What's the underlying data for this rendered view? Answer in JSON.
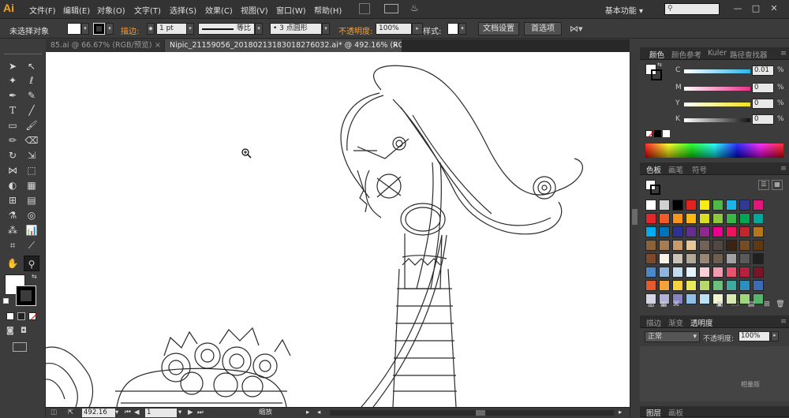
{
  "app": {
    "logo": "Ai",
    "workspace": "基本功能",
    "workspace_arrow": "▾"
  },
  "menu": [
    "文件(F)",
    "编辑(E)",
    "对象(O)",
    "文字(T)",
    "选择(S)",
    "效果(C)",
    "视图(V)",
    "窗口(W)",
    "帮助(H)"
  ],
  "control": {
    "selection": "未选择对象",
    "stroke_label": "描边:",
    "stroke_weight": "1 pt",
    "profile_label": "等比",
    "brush_label": "3 点圆形",
    "opacity_label": "不透明度:",
    "opacity_value": "100%",
    "style_label": "样式:",
    "doc_setup": "文档设置",
    "prefs": "首选项"
  },
  "tabs": [
    {
      "label": "85.ai @ 66.67% (RGB/预览)",
      "close": "×"
    },
    {
      "label": "Nipic_21159056_20180213183018276032.ai* @ 492.16% (RGB/轮廓)",
      "close": "×"
    }
  ],
  "statusbar": {
    "zoom": "492.16",
    "page": "1",
    "tool": "缩放"
  },
  "color_panel": {
    "tabs": [
      "颜色",
      "颜色参考",
      "Kuler",
      "路径查找器"
    ],
    "channels": [
      {
        "label": "C",
        "value": "0.01",
        "grad": "#29b6e8"
      },
      {
        "label": "M",
        "value": "0",
        "grad": "#e8308a"
      },
      {
        "label": "Y",
        "value": "0",
        "grad": "#f2e31a"
      },
      {
        "label": "K",
        "value": "0",
        "grad": "#111111"
      }
    ],
    "pct": "%"
  },
  "swatch_panel": {
    "tabs": [
      "色板",
      "画笔",
      "符号"
    ],
    "colors": [
      "#ffffff",
      "#d0d0d0",
      "#000000",
      "#e3231f",
      "#f7ec16",
      "#4eb848",
      "#1eb3e8",
      "#2e3a93",
      "#e2167d",
      "#e5262c",
      "#f15b2a",
      "#f7941e",
      "#fcb813",
      "#d8df21",
      "#8dc63f",
      "#39b54a",
      "#00a651",
      "#00a99d",
      "#00aeef",
      "#0072bc",
      "#2e3192",
      "#662d91",
      "#92278f",
      "#ec008c",
      "#ed145b",
      "#c1272d",
      "#b8761a",
      "#8c6239",
      "#a67c52",
      "#c69c6d",
      "#e6c79c",
      "#736357",
      "#534741",
      "#3c2415",
      "#754c24",
      "#603913",
      "#7d4a2c",
      "#f9f2e7",
      "#ccc4b6",
      "#b3a999",
      "#998675",
      "#6d5e4e",
      "#a3a3a3",
      "#5a5a5a",
      "#202020",
      "#4a88c8",
      "#8fb4de",
      "#c3d9f0",
      "#e5f1fb",
      "#f8cfd8",
      "#f29bb0",
      "#e8546f",
      "#b9203e",
      "#7a1428",
      "#e35b2e",
      "#f4a23a",
      "#f7d23c",
      "#e9e95d",
      "#b7d86a",
      "#6dbf7c",
      "#3fa9a0",
      "#2c8fbf",
      "#3b6cb5",
      "#d6d6e8",
      "#b1b0d6",
      "#8584bf",
      "#8fc0e8",
      "#bee0f5",
      "#f0f5d0",
      "#d6ebb0",
      "#9ed67e",
      "#55b56b"
    ]
  },
  "transparency_panel": {
    "tabs": [
      "描边",
      "渐变",
      "透明度"
    ],
    "mode": "正常",
    "opacity_label": "不透明度:",
    "opacity_value": "100%"
  },
  "bottom_tabs": [
    "图层",
    "画板"
  ],
  "watermark": "相量版"
}
